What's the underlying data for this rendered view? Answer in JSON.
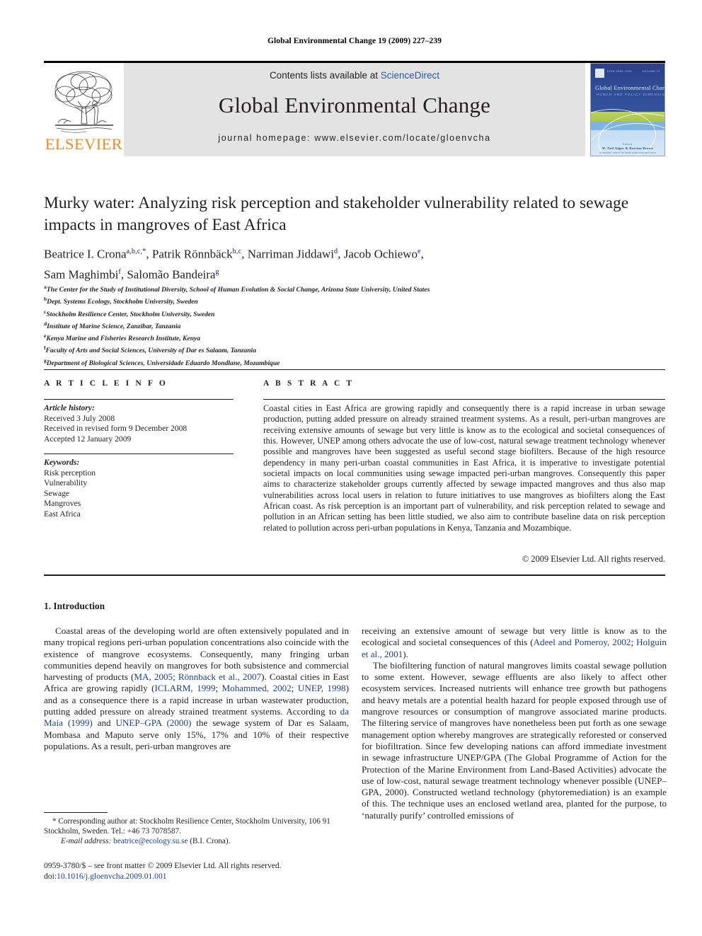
{
  "running_head": "Global Environmental Change 19 (2009) 227–239",
  "header": {
    "contents_prefix": "Contents lists available at ",
    "sciencedirect": "ScienceDirect",
    "journal_name": "Global Environmental Change",
    "homepage": "journal homepage: www.elsevier.com/locate/gloenvcha",
    "publisher_logo_text": "ELSEVIER",
    "cover": {
      "title": "Global Environmental Change",
      "subtitle": "HUMAN AND POLICY DIMENSIONS",
      "header_left": "ISSN 0959-3780",
      "header_right": "VOLUME 19",
      "footer_top": "Editors",
      "footer_mid": "W. Neil Adger & Katrina Brown",
      "footer_bot": "Available online at www.sciencedirect.com"
    }
  },
  "article": {
    "title": "Murky water: Analyzing risk perception and stakeholder vulnerability related to sewage impacts in mangroves of East Africa",
    "authors": [
      {
        "name": "Beatrice I. Crona",
        "marks": "a,b,c,*",
        "sep": ", "
      },
      {
        "name": "Patrik Rönnbäck",
        "marks": "b,c",
        "sep": ", "
      },
      {
        "name": "Narriman Jiddawi",
        "marks": "d",
        "sep": ", "
      },
      {
        "name": "Jacob Ochiewo",
        "marks": "e",
        "sep": ","
      },
      {
        "name": "Sam Maghimbi",
        "marks": "f",
        "sep": ", "
      },
      {
        "name": "Salomão Bandeira",
        "marks": "g",
        "sep": ""
      }
    ],
    "affiliations": [
      {
        "mark": "a",
        "text": "The Center for the Study of Institutional Diversity, School of Human Evolution & Social Change, Arizona State University, United States"
      },
      {
        "mark": "b",
        "text": "Dept. Systems Ecology, Stockholm University, Sweden"
      },
      {
        "mark": "c",
        "text": "Stockholm Resilience Center, Stockholm University, Sweden"
      },
      {
        "mark": "d",
        "text": "Institute of Marine Science, Zanzibar, Tanzania"
      },
      {
        "mark": "e",
        "text": "Kenya Marine and Fisheries Research Institute, Kenya"
      },
      {
        "mark": "f",
        "text": "Faculty of Arts and Social Sciences, University of Dar es Salaam, Tanzania"
      },
      {
        "mark": "g",
        "text": "Department of Biological Sciences, Universidade Eduardo Mondlane, Mozambique"
      }
    ]
  },
  "article_info": {
    "label": "A R T I C L E  I N F O",
    "history_label": "Article history:",
    "history": [
      "Received 3 July 2008",
      "Received in revised form 9 December 2008",
      "Accepted 12 January 2009"
    ],
    "keywords_label": "Keywords:",
    "keywords": [
      "Risk perception",
      "Vulnerability",
      "Sewage",
      "Mangroves",
      "East Africa"
    ]
  },
  "abstract": {
    "label": "A B S T R A C T",
    "text": "Coastal cities in East Africa are growing rapidly and consequently there is a rapid increase in urban sewage production, putting added pressure on already strained treatment systems. As a result, peri-urban mangroves are receiving extensive amounts of sewage but very little is know as to the ecological and societal consequences of this. However, UNEP among others advocate the use of low-cost, natural sewage treatment technology whenever possible and mangroves have been suggested as useful second stage biofilters. Because of the high resource dependency in many peri-urban coastal communities in East Africa, it is imperative to investigate potential societal impacts on local communities using sewage impacted peri-urban mangroves. Consequently this paper aims to characterize stakeholder groups currently affected by sewage impacted mangroves and thus also map vulnerabilities across local users in relation to future initiatives to use mangroves as biofilters along the East African coast. As risk perception is an important part of vulnerability, and risk perception related to sewage and pollution in an African setting has been little studied, we also aim to contribute baseline data on risk perception related to pollution across peri-urban populations in Kenya, Tanzania and Mozambique.",
    "copyright": "© 2009 Elsevier Ltd. All rights reserved."
  },
  "body": {
    "section_heading": "1. Introduction",
    "left_paragraphs": [
      "Coastal areas of the developing world are often extensively populated and in many tropical regions peri-urban population concentrations also coincide with the existence of mangrove ecosystems. Consequently, many fringing urban communities depend heavily on mangroves for both subsistence and commercial harvesting of products (MA, 2005; Rönnback et al., 2007). Coastal cities in East Africa are growing rapidly (ICLARM, 1999; Mohammed, 2002; UNEP, 1998) and as a consequence there is a rapid increase in urban wastewater production, putting added pressure on already strained treatment systems. According to da Maia (1999) and UNEP–GPA (2000) the sewage system of Dar es Salaam, Mombasa and Maputo serve only 15%, 17% and 10% of their respective populations. As a result, peri-urban mangroves are"
    ],
    "right_paragraphs": [
      "receiving an extensive amount of sewage but very little is know as to the ecological and societal consequences of this (Adeel and Pomeroy, 2002; Holguin et al., 2001).",
      "The biofiltering function of natural mangroves limits coastal sewage pollution to some extent. However, sewage effluents are also likely to affect other ecosystem services. Increased nutrients will enhance tree growth but pathogens and heavy metals are a potential health hazard for people exposed through use of mangrove resources or consumption of mangrove associated marine products. The filtering service of mangroves have nonetheless been put forth as one sewage management option whereby mangroves are strategically reforested or conserved for biofiltration. Since few developing nations can afford immediate investment in sewage infrastructure UNEP/GPA (The Global Programme of Action for the Protection of the Marine Environment from Land-Based Activities) advocate the use of low-cost, natural sewage treatment technology whenever possible (UNEP–GPA, 2000). Constructed wetland technology (phytoremediation) is an example of this. The technique uses an enclosed wetland area, planted for the purpose, to ‘naturally purify’ controlled emissions of"
    ]
  },
  "footnotes": {
    "corresponding": "* Corresponding author at: Stockholm Resilience Center, Stockholm University, 106 91 Stockholm, Sweden. Tel.: +46 73 7078587.",
    "email_label": "E-mail address:",
    "email": "beatrice@ecology.su.se",
    "email_suffix": "(B.I. Crona).",
    "issn_line": "0959-3780/$ – see front matter © 2009 Elsevier Ltd. All rights reserved.",
    "doi_label": "doi:",
    "doi": "10.1016/j.gloenvcha.2009.01.001"
  }
}
